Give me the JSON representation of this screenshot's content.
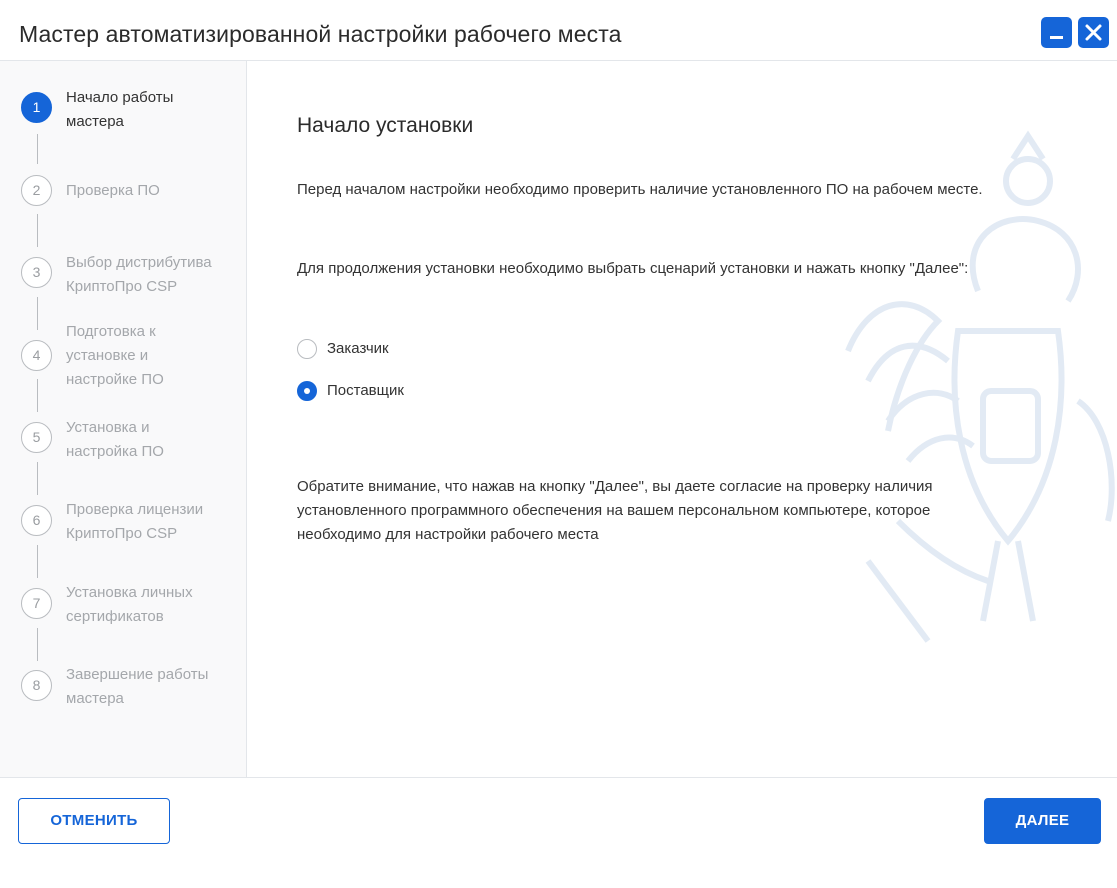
{
  "window": {
    "title": "Мастер автоматизированной настройки рабочего места",
    "accent_color": "#1565d8",
    "controls": [
      "minimize-icon",
      "close-icon"
    ]
  },
  "sidebar": {
    "steps": [
      {
        "number": "1",
        "label": "Начало работы мастера",
        "state": "active"
      },
      {
        "number": "2",
        "label": "Проверка ПО",
        "state": "inactive"
      },
      {
        "number": "3",
        "label": "Выбор дистрибутива КриптоПро CSP",
        "state": "inactive"
      },
      {
        "number": "4",
        "label": "Подготовка к установке и настройке ПО",
        "state": "inactive"
      },
      {
        "number": "5",
        "label": "Установка и настройка ПО",
        "state": "inactive"
      },
      {
        "number": "6",
        "label": "Проверка лицензии КриптоПро CSP",
        "state": "inactive"
      },
      {
        "number": "7",
        "label": "Установка личных сертификатов",
        "state": "inactive"
      },
      {
        "number": "8",
        "label": "Завершение работы мастера",
        "state": "inactive"
      }
    ]
  },
  "main": {
    "heading": "Начало установки",
    "intro": "Перед началом настройки необходимо проверить наличие установленного ПО на рабочем месте.",
    "instruction": "Для продолжения установки необходимо выбрать сценарий установки и нажать кнопку \"Далее\":",
    "options": [
      {
        "label": "Заказчик",
        "checked": false
      },
      {
        "label": "Поставщик",
        "checked": true
      }
    ],
    "notice": "Обратите внимание, что нажав на кнопку \"Далее\", вы даете согласие на проверку наличия установленного программного обеспечения на вашем персональном компьютере, которое необходимо для настройки рабочего места"
  },
  "footer": {
    "cancel_label": "ОТМЕНИТЬ",
    "next_label": "ДАЛЕЕ"
  }
}
